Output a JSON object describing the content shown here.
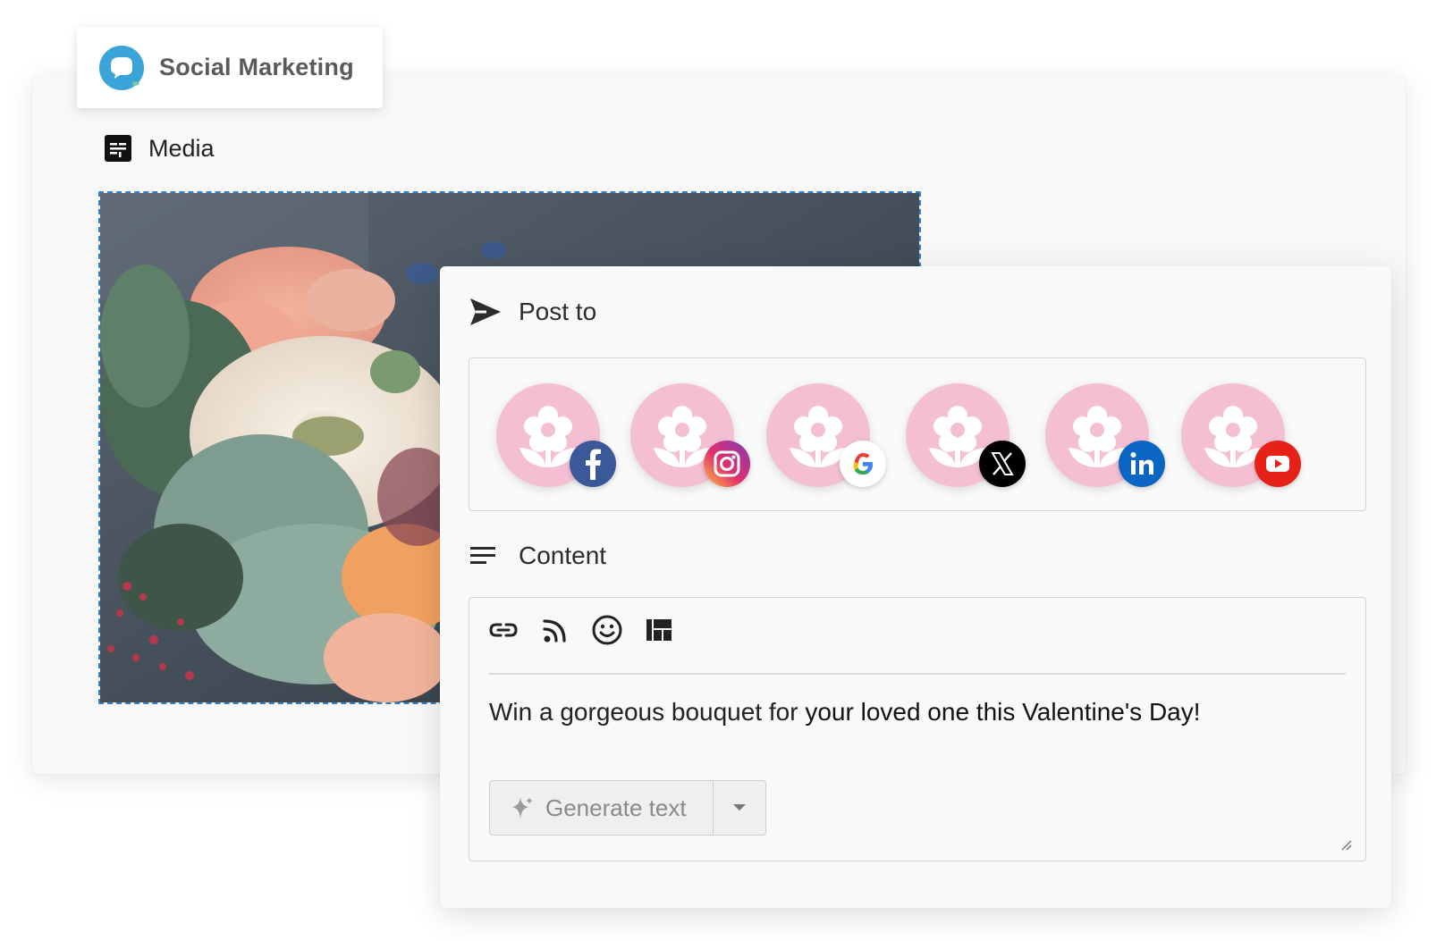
{
  "app": {
    "brand_title": "Social Marketing",
    "brand_logo_icon": "chat-bubble-icon",
    "accent_color": "#3aa4d8"
  },
  "media": {
    "label": "Media",
    "icon": "media-grid-icon",
    "image_alt": "flower-bouquet-photo"
  },
  "post_to": {
    "label": "Post to",
    "icon": "send-icon",
    "accounts": [
      {
        "network": "facebook",
        "badge_icon": "facebook-icon",
        "badge_color": "#3b5998"
      },
      {
        "network": "instagram",
        "badge_icon": "instagram-icon",
        "badge_color": "#c13584"
      },
      {
        "network": "google",
        "badge_icon": "google-icon",
        "badge_color": "#ffffff"
      },
      {
        "network": "x",
        "badge_icon": "x-icon",
        "badge_color": "#000000"
      },
      {
        "network": "linkedin",
        "badge_icon": "linkedin-icon",
        "badge_color": "#0a66c2"
      },
      {
        "network": "youtube",
        "badge_icon": "youtube-icon",
        "badge_color": "#e62117"
      }
    ],
    "avatar_color": "#f4bfd3"
  },
  "content": {
    "label": "Content",
    "icon": "lines-icon",
    "toolbar": [
      "link-icon",
      "rss-icon",
      "emoji-icon",
      "layout-icon"
    ],
    "post_text_part1": "Win a gorgeous bouquet for ",
    "post_text_part2": "your loved one this Valentine's Day!",
    "generate_label": "Generate text"
  }
}
